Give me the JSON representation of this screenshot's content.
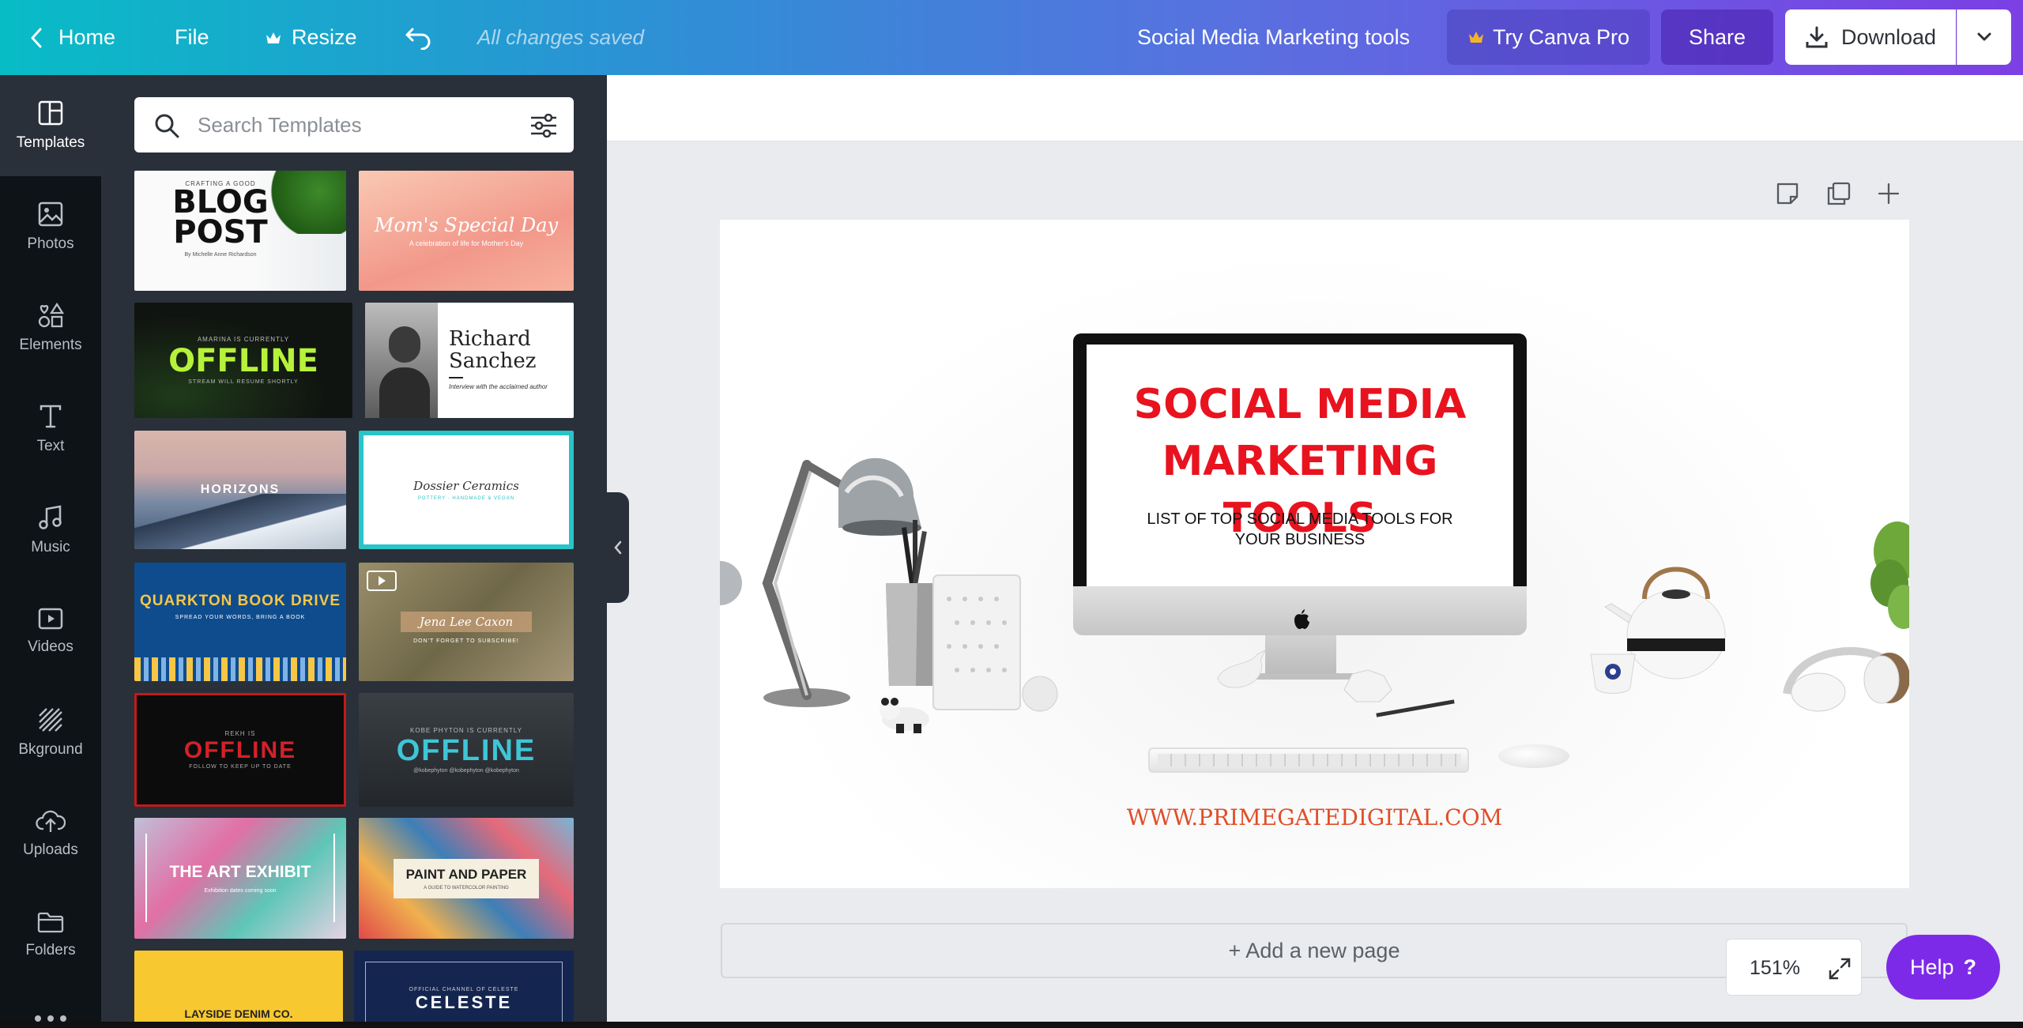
{
  "topbar": {
    "home_label": "Home",
    "file_label": "File",
    "resize_label": "Resize",
    "status_text": "All changes saved",
    "doc_title": "Social Media Marketing tools",
    "try_pro_label": "Try Canva Pro",
    "share_label": "Share",
    "download_label": "Download"
  },
  "rail": {
    "items": [
      {
        "label": "Templates",
        "icon": "templates-icon"
      },
      {
        "label": "Photos",
        "icon": "photos-icon"
      },
      {
        "label": "Elements",
        "icon": "elements-icon"
      },
      {
        "label": "Text",
        "icon": "text-icon"
      },
      {
        "label": "Music",
        "icon": "music-icon"
      },
      {
        "label": "Videos",
        "icon": "videos-icon"
      },
      {
        "label": "Bkground",
        "icon": "background-icon"
      },
      {
        "label": "Uploads",
        "icon": "uploads-icon"
      },
      {
        "label": "Folders",
        "icon": "folders-icon"
      }
    ]
  },
  "panel": {
    "search_placeholder": "Search Templates",
    "templates": {
      "blog": {
        "small": "CRAFTING A GOOD",
        "title1": "BLOG",
        "title2": "POST",
        "byline": "By Michelle Anne Richardson"
      },
      "moms": {
        "title": "Mom's Special Day",
        "sub": "A celebration of life for Mother's Day"
      },
      "offline1": {
        "top": "AMARINA IS CURRENTLY",
        "title": "OFFLINE",
        "sub": "STREAM WILL RESUME SHORTLY"
      },
      "richard": {
        "name1": "Richard",
        "name2": "Sanchez",
        "sub": "Interview with the acclaimed author"
      },
      "horizons": {
        "title": "HORIZONS"
      },
      "dossier": {
        "title": "Dossier Ceramics",
        "sub": "POTTERY · HANDMADE & VEGAN"
      },
      "quarkton": {
        "title": "QUARKTON BOOK DRIVE",
        "sub": "SPREAD YOUR WORDS, BRING A BOOK"
      },
      "jena": {
        "title": "Jena Lee Caxon",
        "sub": "DON'T FORGET TO SUBSCRIBE!"
      },
      "offline2": {
        "top": "REKH IS",
        "title": "OFFLINE",
        "sub": "FOLLOW TO KEEP UP TO DATE"
      },
      "offline3": {
        "top": "KOBE PHYTON IS CURRENTLY",
        "title": "OFFLINE",
        "sub": "@kobephyton   @kobephyton   @kobephyton"
      },
      "art": {
        "title": "THE ART EXHIBIT",
        "sub": "Exhibition dates coming soon"
      },
      "paint": {
        "title": "PAINT AND PAPER",
        "sub": "A GUIDE TO WATERCOLOR PAINTING"
      },
      "layside": {
        "title": "LAYSIDE DENIM CO."
      },
      "celeste": {
        "top": "OFFICIAL CHANNEL OF CELESTE",
        "title": "CELESTE"
      }
    }
  },
  "canvas": {
    "headline1": "SOCIAL MEDIA",
    "headline2": "MARKETING TOOLS",
    "subline1": "LIST OF TOP SOCIAL MEDIA TOOLS FOR",
    "subline2": "YOUR BUSINESS",
    "website": "WWW.PRIMEGATEDIGITAL.COM",
    "add_page_label": "+ Add a new page"
  },
  "footer": {
    "zoom": "151%",
    "help_label": "Help",
    "help_glyph": "?"
  },
  "colors": {
    "headline": "#e8131f",
    "website": "#e04e28",
    "help": "#7d2ae8",
    "panel": "#293039",
    "rail": "#0e1318"
  }
}
